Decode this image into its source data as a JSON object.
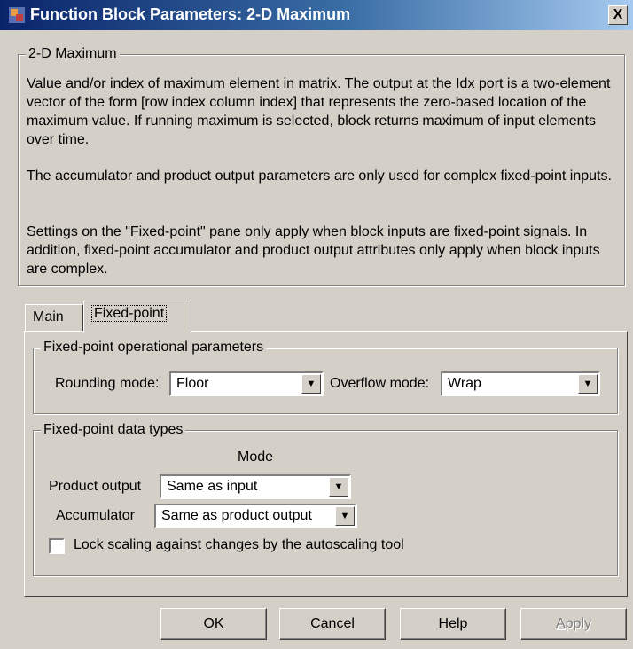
{
  "window": {
    "title": "Function Block Parameters: 2-D Maximum",
    "close_glyph": "X"
  },
  "description": {
    "legend": "2-D Maximum",
    "paragraph1": "Value and/or index of maximum element in matrix. The output at the Idx port is a two-element vector of the form [row index column index] that represents the zero-based location of the maximum value. If running maximum is selected, block returns maximum of input elements over time.",
    "paragraph2": "The accumulator and product output parameters are only used for complex fixed-point inputs.",
    "paragraph3": "Settings on the \"Fixed-point\" pane only apply when block inputs are fixed-point signals. In addition, fixed-point accumulator and product output attributes only apply when block inputs are complex."
  },
  "tabs": [
    {
      "label": "Main"
    },
    {
      "label": "Fixed-point"
    }
  ],
  "operational": {
    "legend": "Fixed-point operational parameters",
    "rounding_label": "Rounding mode:",
    "rounding_value": "Floor",
    "overflow_label": "Overflow mode:",
    "overflow_value": "Wrap"
  },
  "datatypes": {
    "legend": "Fixed-point data types",
    "mode_header": "Mode",
    "product_label": "Product output",
    "product_value": "Same as input",
    "accumulator_label": "Accumulator",
    "accumulator_value": "Same as product output",
    "lock_label": "Lock scaling against changes by the autoscaling tool",
    "lock_checked": false
  },
  "buttons": {
    "ok_mnemonic": "O",
    "ok_rest": "K",
    "cancel_mnemonic": "C",
    "cancel_rest": "ancel",
    "help_mnemonic": "H",
    "help_rest": "elp",
    "apply_mnemonic": "A",
    "apply_rest": "pply"
  },
  "colors": {
    "titlebar_start": "#0a246a",
    "titlebar_end": "#a6caf0",
    "dialog_bg": "#d4d0c8"
  }
}
